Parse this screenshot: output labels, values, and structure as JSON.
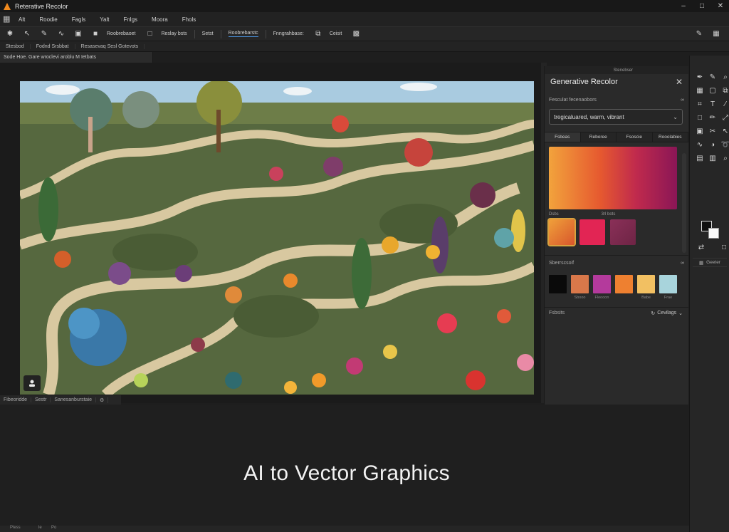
{
  "window": {
    "title": "Reterative Recolor"
  },
  "menu": {
    "items": [
      "Alt",
      "Roodie",
      "Fagls",
      "Yalt",
      "Fnlgs",
      "Moora",
      "Fhols"
    ]
  },
  "toolbar": {
    "labels": [
      "Roobrebaoet",
      "Reslay bsts",
      "Setst",
      "Roobrebarstc",
      "Fnngrahbase:",
      "Ceisit"
    ]
  },
  "options": {
    "items": [
      "Stesbod",
      "Fodnd Srsbbat",
      "Resasevaq Sesl Gotevots"
    ]
  },
  "document": {
    "tab_label": "Sode Hoe. Gare wroclevi aroblu M Ietbats"
  },
  "status": {
    "items": [
      "Fibeoridde",
      "Sestr",
      "Sanesanburstaie"
    ]
  },
  "caption": "AI to Vector Graphics",
  "panel": {
    "tab_label": "Stenebser",
    "title": "Generative Recolor",
    "prompt_section_label": "Fesculat fecenaobors",
    "prompt_value": "tregicaluared, warm, vibrant",
    "pill_tabs": [
      "Fsbeas",
      "Reboree",
      "Fsoscie",
      "Rooolabies"
    ],
    "sub_labels": [
      "Dsbs",
      "3rl bots"
    ],
    "variants_colors": [
      "#e5822c",
      "#e22554",
      "#7f2a4c"
    ],
    "swatch_section_label": "Sberrscsoif",
    "swatches": [
      "#0a0a0a",
      "#d9784a",
      "#b43a9c",
      "#ee8030",
      "#f2c062",
      "#a8d4dc"
    ],
    "swatch_labels": [
      "",
      "Sbooo",
      "Fleooon",
      "",
      "Babe",
      "Frae"
    ],
    "results_label": "Fsbsits",
    "generate_label": "Cevilags"
  },
  "tools": {
    "bottom_label": "Geeter",
    "icons": [
      "pen-icon",
      "brush-icon",
      "eyedrop-icon",
      "grid-icon",
      "shape-icon",
      "layer-icon",
      "crop-icon",
      "text-icon",
      "line-icon",
      "rect-icon",
      "pencil-icon",
      "transform-icon",
      "frame-icon",
      "scissors-icon",
      "select-icon",
      "warp-icon",
      "blend-icon",
      "lasso-icon",
      "gradient-icon",
      "mesh-icon",
      "zoom-icon"
    ]
  },
  "bottom_strip": [
    "Pless",
    "le",
    "Po"
  ],
  "colors": {
    "accent_blue": "#4a8fd9",
    "selected_outline": "#d8a23e",
    "app_orange": "#f28a1e"
  }
}
